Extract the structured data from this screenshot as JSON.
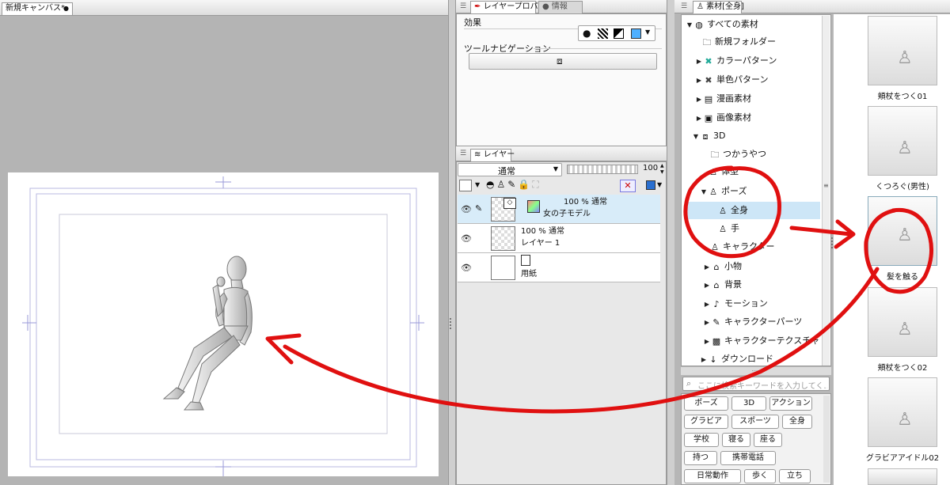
{
  "canvas": {
    "tab_title": "新規キャンバス*"
  },
  "layer_property": {
    "tab_label": "レイヤープロパティ",
    "tab_info": "情報",
    "effect_label": "効果",
    "tool_navigation_label": "ツールナビゲーション"
  },
  "layer_panel": {
    "tab_label": "レイヤー",
    "blend_mode": "通常",
    "opacity": "100",
    "layers": [
      {
        "opacity_mode": "100 % 通常",
        "name": "女の子モデル"
      },
      {
        "opacity_mode": "100 % 通常",
        "name": "レイヤー 1"
      },
      {
        "opacity_mode": "",
        "name": "用紙"
      }
    ]
  },
  "material_panel": {
    "tab_label": "素材[全身]",
    "tree": [
      {
        "label": "すべての素材",
        "icon": "circle-icon"
      },
      {
        "label": "新規フォルダー",
        "icon": "folder-icon"
      },
      {
        "label": "カラーパターン",
        "icon": "color-pattern-icon"
      },
      {
        "label": "単色パターン",
        "icon": "mono-pattern-icon"
      },
      {
        "label": "漫画素材",
        "icon": "manga-icon"
      },
      {
        "label": "画像素材",
        "icon": "image-icon"
      },
      {
        "label": "3D",
        "icon": "cube-icon"
      },
      {
        "label": "つかうやつ",
        "icon": "folder-icon"
      },
      {
        "label": "体型",
        "icon": "figure-icon"
      },
      {
        "label": "ポーズ",
        "icon": "figure-icon"
      },
      {
        "label": "全身",
        "icon": "figure-icon"
      },
      {
        "label": "手",
        "icon": "figure-icon"
      },
      {
        "label": "キャラクター",
        "icon": "character-icon"
      },
      {
        "label": "小物",
        "icon": "prop-icon"
      },
      {
        "label": "背景",
        "icon": "background-icon"
      },
      {
        "label": "モーション",
        "icon": "motion-icon"
      },
      {
        "label": "キャラクターパーツ",
        "icon": "parts-icon"
      },
      {
        "label": "キャラクターテクスチャ",
        "icon": "texture-icon"
      },
      {
        "label": "ダウンロード",
        "icon": "download-icon"
      }
    ],
    "search_placeholder": "ここに検索キーワードを入力してく…",
    "tags": [
      [
        "ポーズ",
        "3D",
        "アクション"
      ],
      [
        "グラビア",
        "スポーツ",
        "全身"
      ],
      [
        "学校",
        "寝る",
        "座る"
      ],
      [
        "持つ",
        "携帯電話"
      ],
      [
        "日常動作",
        "歩く",
        "立ち"
      ]
    ],
    "thumbnails": [
      "頬杖をつく01",
      "くつろぐ(男性)",
      "髪を触る",
      "頬杖をつく02",
      "グラビアアイドル02"
    ]
  },
  "colors": {
    "annotation": "#e01010",
    "selected_row": "#cde6f7"
  }
}
